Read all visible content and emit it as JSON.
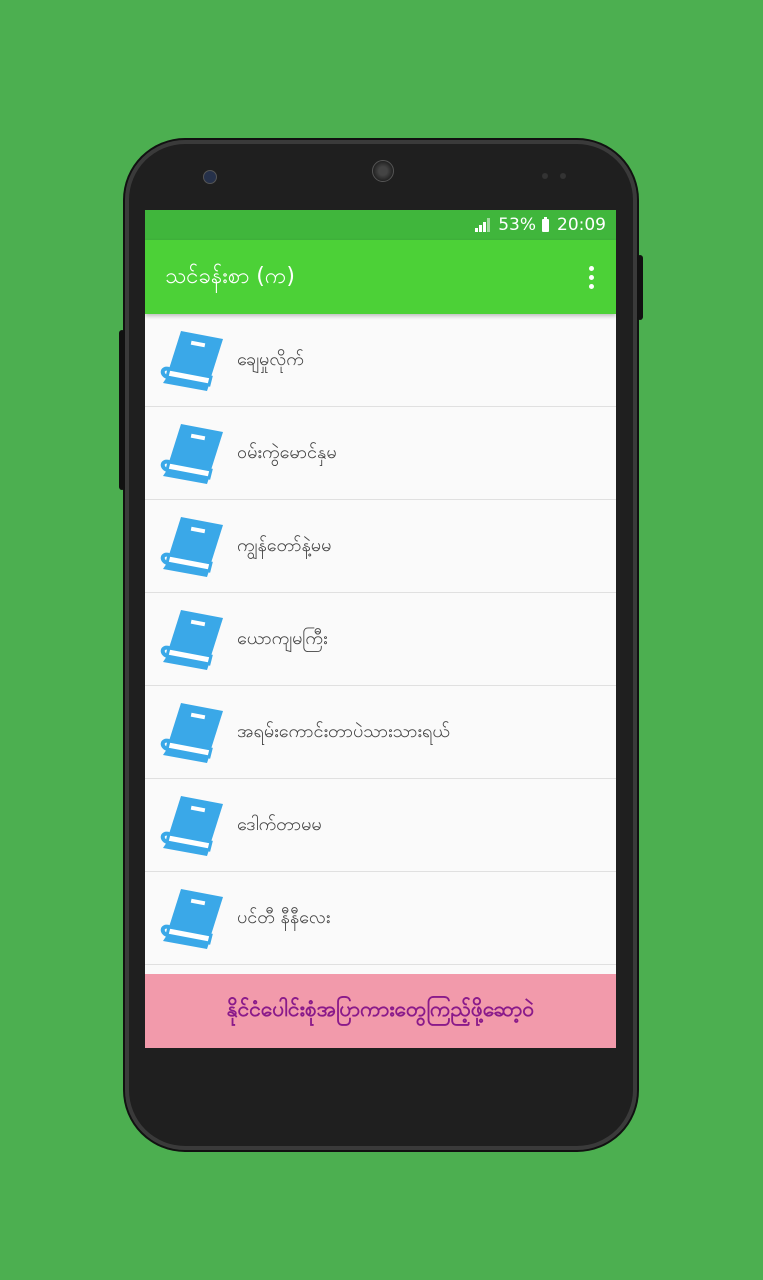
{
  "status_bar": {
    "battery": "53%",
    "time": "20:09"
  },
  "app_bar": {
    "title": "သင်ခန်းစာ (က)"
  },
  "list": {
    "items": [
      {
        "label": "ချေမှုလိုက်"
      },
      {
        "label": "ဝမ်းကွဲမောင်နှမ"
      },
      {
        "label": "ကျွန်တော်နဲ့မမ"
      },
      {
        "label": "ယောကျမကြီး"
      },
      {
        "label": "အရမ်းကောင်းတာပဲသားသားရယ်"
      },
      {
        "label": "ဒေါက်တာမမ"
      },
      {
        "label": "ပင်တီ နီနီလေး"
      }
    ]
  },
  "banner": {
    "text": "နိုင်ငံပေါင်းစုံအပြာကားတွေကြည့်ဖို့ဆော့ဝဲ"
  },
  "colors": {
    "background": "#4caf50",
    "status_bar": "#40b63c",
    "app_bar": "#4cd137",
    "book_icon": "#3aa8e8",
    "banner_bg": "#f29aab",
    "banner_text": "#8a1a8a"
  },
  "icons": {
    "list_item": "book-icon",
    "overflow": "more-vert-icon",
    "signal": "signal-icon",
    "battery": "battery-icon"
  }
}
